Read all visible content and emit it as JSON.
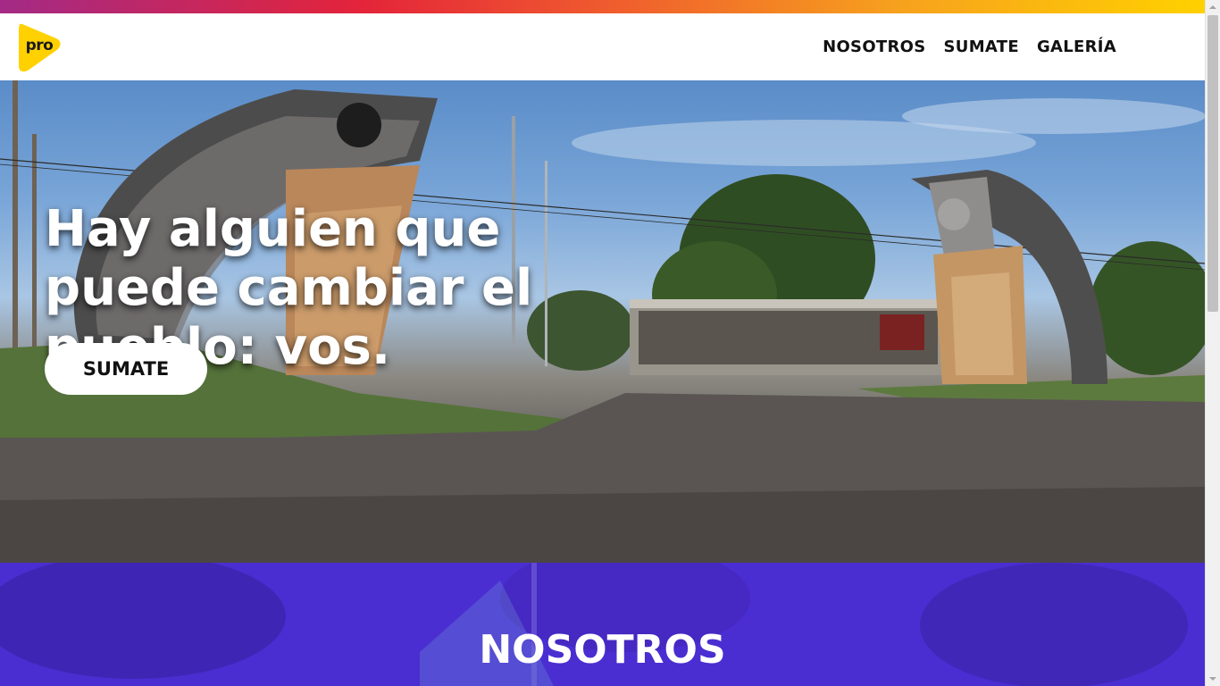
{
  "brand": {
    "logo_text": "pro",
    "logo_color": "#ffd100",
    "gradient_colors": [
      "#a32a86",
      "#e4243a",
      "#ef5a2e",
      "#f7a21d",
      "#ffd100"
    ]
  },
  "nav": {
    "items": [
      {
        "label": "NOSOTROS"
      },
      {
        "label": "SUMATE"
      },
      {
        "label": "GALERÍA"
      }
    ]
  },
  "hero": {
    "title": "Hay alguien que puede cambiar el pueblo: vos.",
    "button_label": "SUMATE"
  },
  "about": {
    "title": "NOSOTROS",
    "background_color": "#4a2ed1"
  }
}
